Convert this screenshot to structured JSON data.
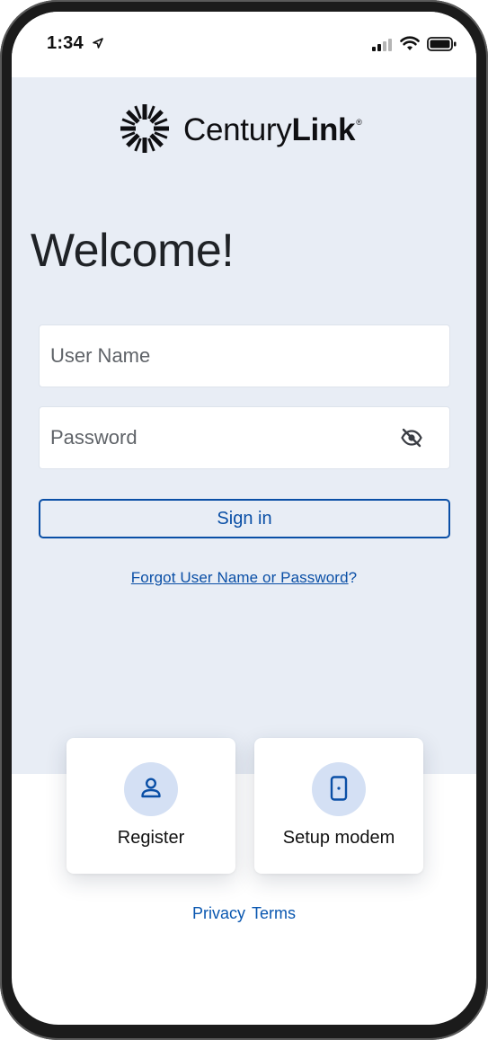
{
  "status_bar": {
    "time": "1:34",
    "icons": [
      "location-arrow-icon",
      "cellular-signal-icon",
      "wifi-icon",
      "battery-icon"
    ]
  },
  "brand": {
    "name_light": "Century",
    "name_bold": "Link",
    "registered_mark": "®",
    "logo_icon": "centurylink-burst-icon"
  },
  "login": {
    "heading": "Welcome!",
    "username_placeholder": "User Name",
    "password_placeholder": "Password",
    "password_toggle_icon": "eye-slash-icon",
    "sign_in_label": "Sign in",
    "forgot_link": "Forgot User Name or Password",
    "forgot_suffix": "?"
  },
  "cards": [
    {
      "label": "Register",
      "icon": "person-icon"
    },
    {
      "label": "Setup modem",
      "icon": "modem-icon"
    }
  ],
  "footer": {
    "privacy": "Privacy",
    "terms": "Terms"
  },
  "colors": {
    "primary": "#0a4fa6",
    "top_background": "#e8edf5",
    "icon_circle": "#d4e0f4"
  }
}
